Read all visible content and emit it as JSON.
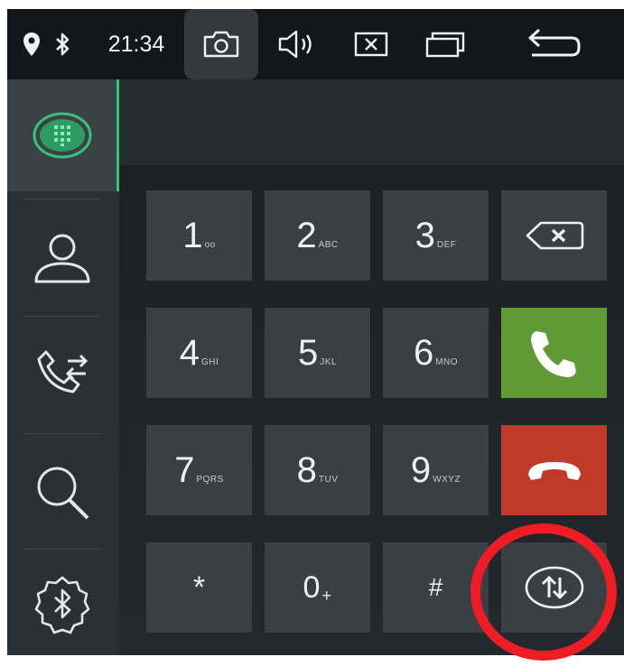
{
  "status_bar": {
    "time": "21:34",
    "icons": [
      "location-icon",
      "bluetooth-icon",
      "camera-icon",
      "volume-icon",
      "close-window-icon",
      "recent-apps-icon",
      "back-icon"
    ]
  },
  "sidebar": {
    "items": [
      {
        "name": "dialpad",
        "icon": "dialpad-icon",
        "active": true
      },
      {
        "name": "contacts",
        "icon": "contact-icon"
      },
      {
        "name": "call-log",
        "icon": "call-transfer-icon"
      },
      {
        "name": "search",
        "icon": "search-icon"
      },
      {
        "name": "bluetooth-settings",
        "icon": "bluetooth-settings-icon"
      }
    ]
  },
  "keypad": {
    "keys": [
      {
        "digit": "1",
        "letters": "oo"
      },
      {
        "digit": "2",
        "letters": "ABC"
      },
      {
        "digit": "3",
        "letters": "DEF"
      },
      {
        "digit": "4",
        "letters": "GHI"
      },
      {
        "digit": "5",
        "letters": "JKL"
      },
      {
        "digit": "6",
        "letters": "MNO"
      },
      {
        "digit": "7",
        "letters": "PQRS"
      },
      {
        "digit": "8",
        "letters": "TUV"
      },
      {
        "digit": "9",
        "letters": "WXYZ"
      },
      {
        "digit": "*",
        "letters": ""
      },
      {
        "digit": "0",
        "letters": "+"
      },
      {
        "digit": "#",
        "letters": ""
      }
    ],
    "actions": [
      "backspace-icon",
      "call-icon",
      "hang-up-icon",
      "swap-audio-icon"
    ]
  },
  "colors": {
    "call": "#5f9a35",
    "hang_up": "#c13a28",
    "accent": "#35c27a",
    "highlight": "#ee1c25"
  }
}
